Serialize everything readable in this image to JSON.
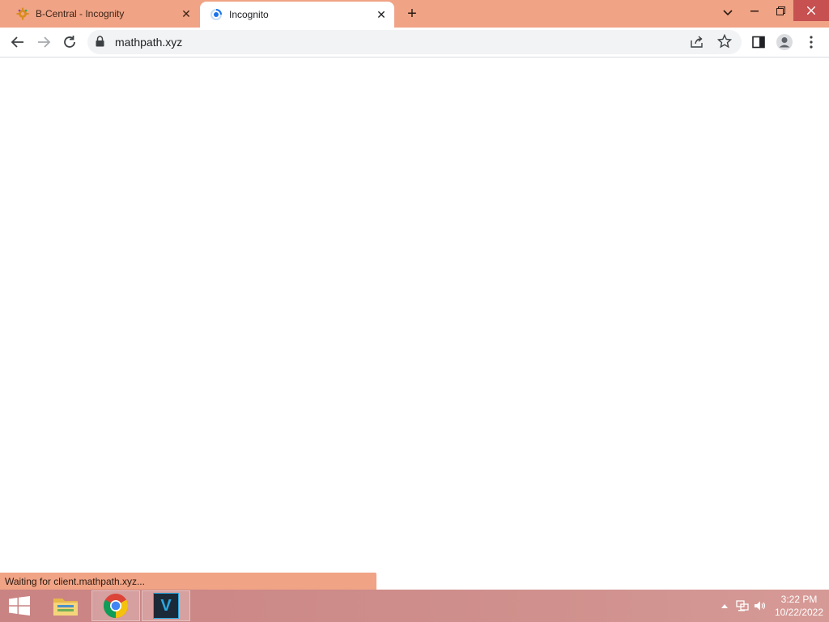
{
  "tabs": [
    {
      "title": "B-Central - Incognity",
      "active": false,
      "icon": "gear-logo-icon"
    },
    {
      "title": "Incognito",
      "active": true,
      "icon": "loading-spinner-icon"
    }
  ],
  "omnibox": {
    "url": "mathpath.xyz"
  },
  "status": {
    "text": "Waiting for client.mathpath.xyz..."
  },
  "taskbar": {
    "apps": [
      "file-explorer-icon",
      "chrome-icon",
      "v-app-icon"
    ],
    "v_letter": "V",
    "clock": {
      "time": "3:22 PM",
      "date": "10/22/2022"
    }
  },
  "colors": {
    "accent": "#f0a385",
    "taskbar": "#c98383"
  }
}
